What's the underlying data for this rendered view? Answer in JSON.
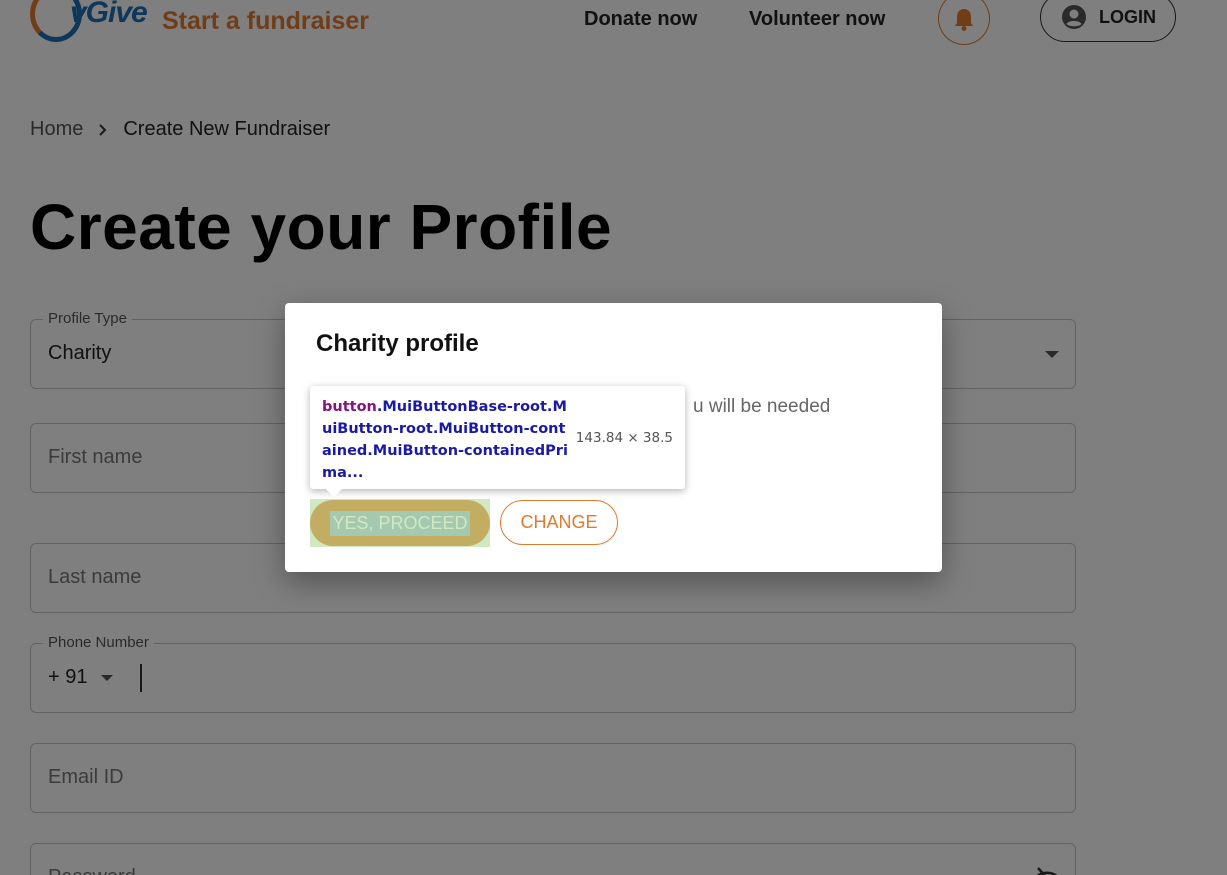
{
  "header": {
    "logo_text": "vGive",
    "start_fundraiser": "Start a fundraiser",
    "donate_now": "Donate now",
    "volunteer_now": "Volunteer now",
    "login": "LOGIN"
  },
  "breadcrumb": {
    "home": "Home",
    "separator": "›",
    "current": "Create New Fundraiser"
  },
  "page_title": "Create your Profile",
  "form": {
    "profile_type": {
      "label": "Profile Type",
      "value": "Charity"
    },
    "first_name": {
      "placeholder": "First name"
    },
    "last_name": {
      "placeholder": "Last name"
    },
    "phone": {
      "label": "Phone Number",
      "code": "+ 91"
    },
    "email": {
      "placeholder": "Email ID"
    },
    "password": {
      "placeholder": "Password"
    }
  },
  "dialog": {
    "title": "Charity profile",
    "text_visible": "u will be needed",
    "proceed_label": "YES, PROCEED",
    "change_label": "CHANGE"
  },
  "devtools_tooltip": {
    "tag": "button",
    "classes": ".MuiButtonBase-root.MuiButton-root.MuiButton-contained.MuiButton-containedPrima...",
    "size": "143.84 × 38.5"
  },
  "colors": {
    "accent": "#e07a2f",
    "brand_blue": "#1f6fb5",
    "overlay": "rgba(0,0,0,0.5)"
  }
}
